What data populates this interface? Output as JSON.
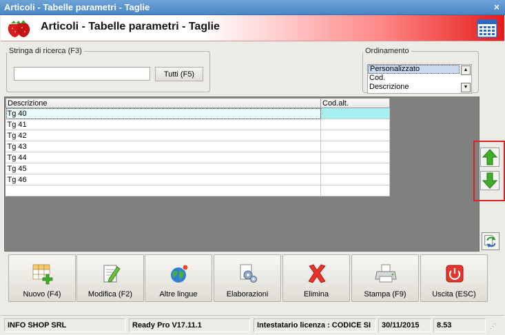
{
  "window": {
    "title": "Articoli - Tabelle parametri - Taglie",
    "close_glyph": "×"
  },
  "header": {
    "title": "Articoli - Tabelle parametri - Taglie",
    "logo_icon": "strawberry-icon",
    "calendar_icon": "calendar-icon"
  },
  "search": {
    "label": "Stringa di ricerca (F3)",
    "value": "",
    "placeholder": "",
    "button_label": "Tutti (F5)"
  },
  "ordering": {
    "label": "Ordinamento",
    "options": [
      "Personalizzato",
      "Cod.",
      "Descrizione"
    ],
    "selected": "Personalizzato"
  },
  "table": {
    "columns": [
      "Descrizione",
      "Cod.alt."
    ],
    "rows": [
      [
        "Tg 40",
        ""
      ],
      [
        "Tg 41",
        ""
      ],
      [
        "Tg 42",
        ""
      ],
      [
        "Tg 43",
        ""
      ],
      [
        "Tg 44",
        ""
      ],
      [
        "Tg 45",
        ""
      ],
      [
        "Tg 46",
        ""
      ],
      [
        "",
        ""
      ]
    ],
    "selected_row": 0
  },
  "side": {
    "up_icon": "arrow-up-icon",
    "down_icon": "arrow-down-icon",
    "refresh_icon": "refresh-icon"
  },
  "toolbar": {
    "nuovo": "Nuovo (F4)",
    "modifica": "Modifica (F2)",
    "lingue": "Altre lingue",
    "elaborazioni": "Elaborazioni",
    "elimina": "Elimina",
    "stampa": "Stampa (F9)",
    "uscita": "Uscita (ESC)"
  },
  "status": {
    "company": "INFO SHOP SRL",
    "version": "Ready Pro V17.11.1",
    "license": "Intestatario licenza : CODICE SI",
    "date": "30/11/2015",
    "time": "8.53"
  },
  "colors": {
    "accent_red": "#e61b1b",
    "selection": "#a8f0f0",
    "grid_bg": "#808080",
    "arrow_green": "#3fae2a"
  }
}
